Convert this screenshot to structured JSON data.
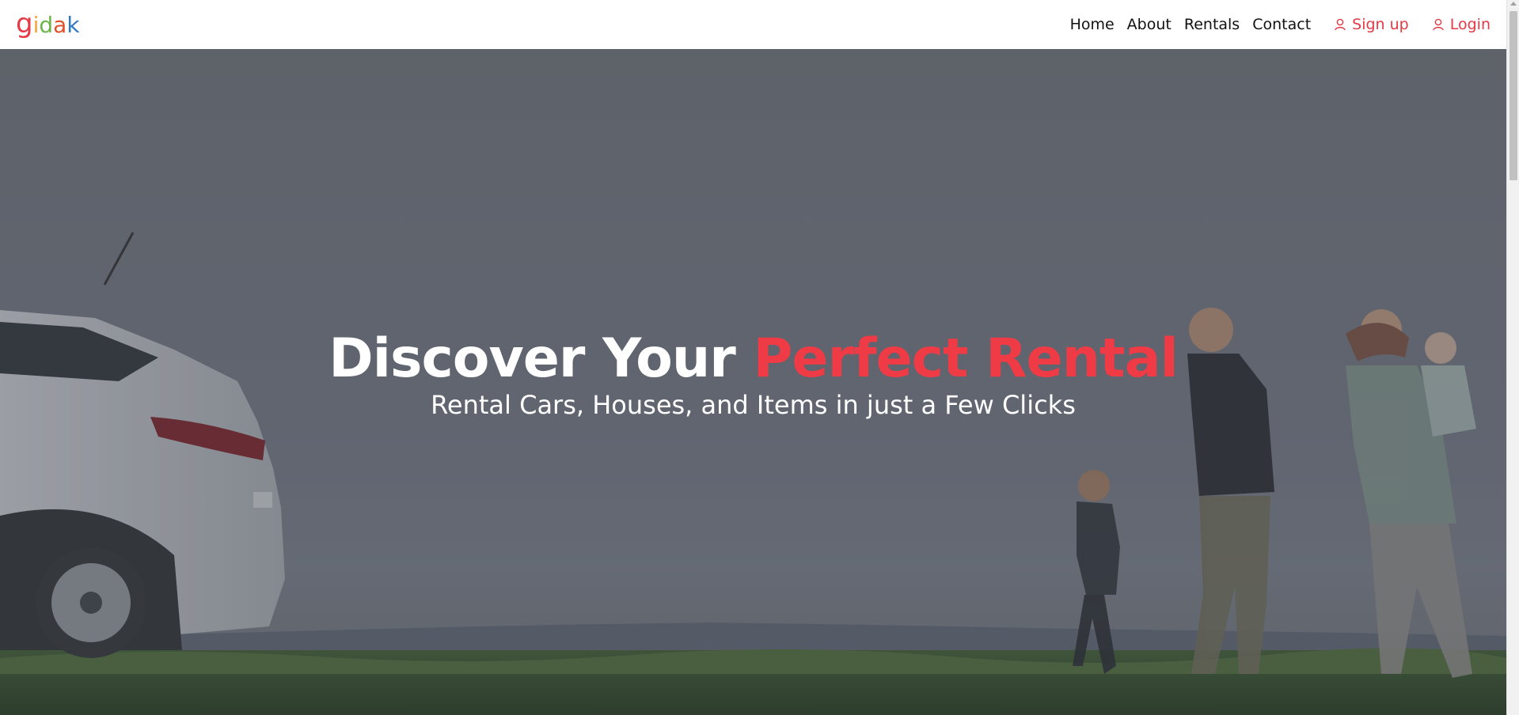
{
  "header": {
    "logo": {
      "letters": [
        "g",
        "i",
        "d",
        "a",
        "k"
      ],
      "colors": [
        "#e53945",
        "#f2a33a",
        "#6cb54b",
        "#e0502a",
        "#2f78c4"
      ]
    },
    "nav": {
      "home": "Home",
      "about": "About",
      "rentals": "Rentals",
      "contact": "Contact"
    },
    "auth": {
      "signup": "Sign up",
      "login": "Login"
    }
  },
  "hero": {
    "title_plain": "Discover Your",
    "title_accent": "Perfect Rental",
    "subtitle": "Rental Cars, Houses, and Items in just a Few Clicks",
    "accent_color": "#ef3b45"
  }
}
